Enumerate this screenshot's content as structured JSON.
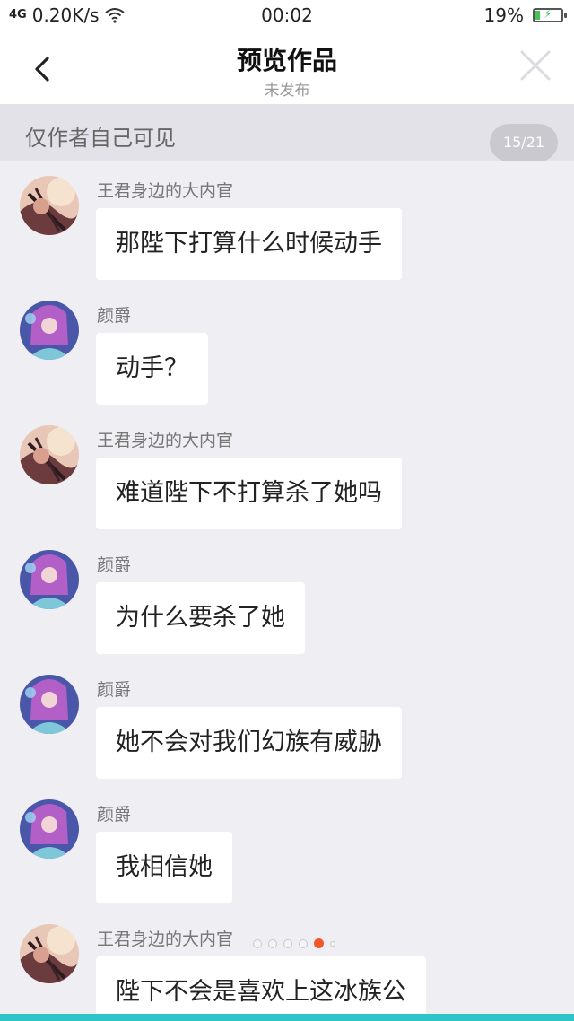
{
  "status_bar": {
    "signal_label": "4G",
    "speed": "0.20K/s",
    "time": "00:02",
    "battery_percent": "19%",
    "battery_level": 0.19,
    "wifi_icon": "wifi-icon"
  },
  "nav": {
    "title": "预览作品",
    "subtitle": "未发布",
    "back_icon": "chevron-left-icon",
    "close_icon": "close-icon"
  },
  "notice": {
    "text": "仅作者自己可见",
    "counter": "15/21"
  },
  "messages": [
    {
      "sender": "王君身边的大内官",
      "text": "那陛下打算什么时候动手",
      "avatar": "avatar-eunuch"
    },
    {
      "sender": "颜爵",
      "text": "动手？",
      "avatar": "avatar-yanjue"
    },
    {
      "sender": "王君身边的大内官",
      "text": "难道陛下不打算杀了她吗",
      "avatar": "avatar-eunuch"
    },
    {
      "sender": "颜爵",
      "text": "为什么要杀了她",
      "avatar": "avatar-yanjue"
    },
    {
      "sender": "颜爵",
      "text": "她不会对我们幻族有威胁",
      "avatar": "avatar-yanjue"
    },
    {
      "sender": "颜爵",
      "text": "我相信她",
      "avatar": "avatar-yanjue"
    },
    {
      "sender": "王君身边的大内官",
      "text": "陛下不会是喜欢上这冰族公",
      "avatar": "avatar-eunuch"
    }
  ],
  "pager": {
    "count": 5,
    "active_index": 4
  },
  "colors": {
    "accent": "#f0582a",
    "bottom_bar": "#2ec4c8",
    "background": "#eeeef3"
  }
}
